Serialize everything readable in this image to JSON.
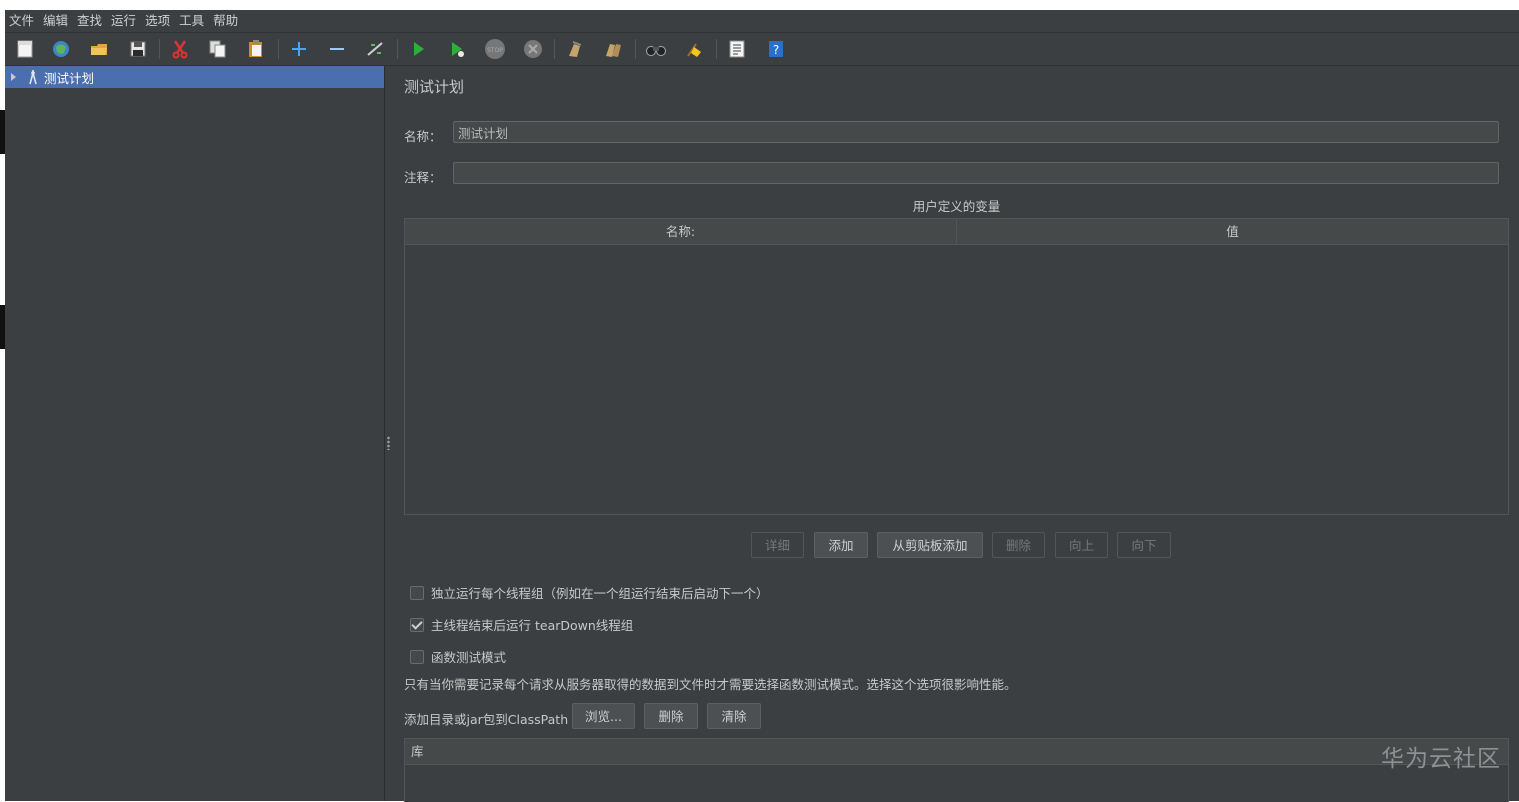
{
  "menu": [
    "文件",
    "编辑",
    "查找",
    "运行",
    "选项",
    "工具",
    "帮助"
  ],
  "toolbar": {
    "icons": [
      "new-icon",
      "templates-icon",
      "open-icon",
      "save-icon",
      "cut-icon",
      "copy-icon",
      "paste-icon",
      "expand-icon",
      "collapse-icon",
      "toggle-icon",
      "start-icon",
      "start-no-pause-icon",
      "stop-icon",
      "shutdown-icon",
      "clear-icon",
      "clear-all-icon",
      "search-icon",
      "reset-search-icon",
      "function-helper-icon",
      "help-icon"
    ]
  },
  "tree": {
    "root_label": "测试计划"
  },
  "panel": {
    "title": "测试计划",
    "name_label": "名称：",
    "name_value": "测试计划",
    "comment_label": "注释：",
    "comment_value": "",
    "variables_title": "用户定义的变量",
    "variables_columns": [
      "名称:",
      "值"
    ]
  },
  "variable_buttons": {
    "detail": "详细",
    "add": "添加",
    "add_from_clipboard": "从剪贴板添加",
    "delete": "删除",
    "up": "向上",
    "down": "向下"
  },
  "options": {
    "serialize_label": "独立运行每个线程组（例如在一个组运行结束后启动下一个）",
    "serialize_checked": false,
    "teardown_label": "主线程结束后运行 tearDown线程组",
    "teardown_checked": true,
    "functional_label": "函数测试模式",
    "functional_checked": false,
    "functional_hint": "只有当你需要记录每个请求从服务器取得的数据到文件时才需要选择函数测试模式。选择这个选项很影响性能。"
  },
  "classpath": {
    "label": "添加目录或jar包到ClassPath",
    "browse": "浏览...",
    "delete": "删除",
    "clear": "清除",
    "library_column": "库"
  },
  "watermark": "华为云社区"
}
